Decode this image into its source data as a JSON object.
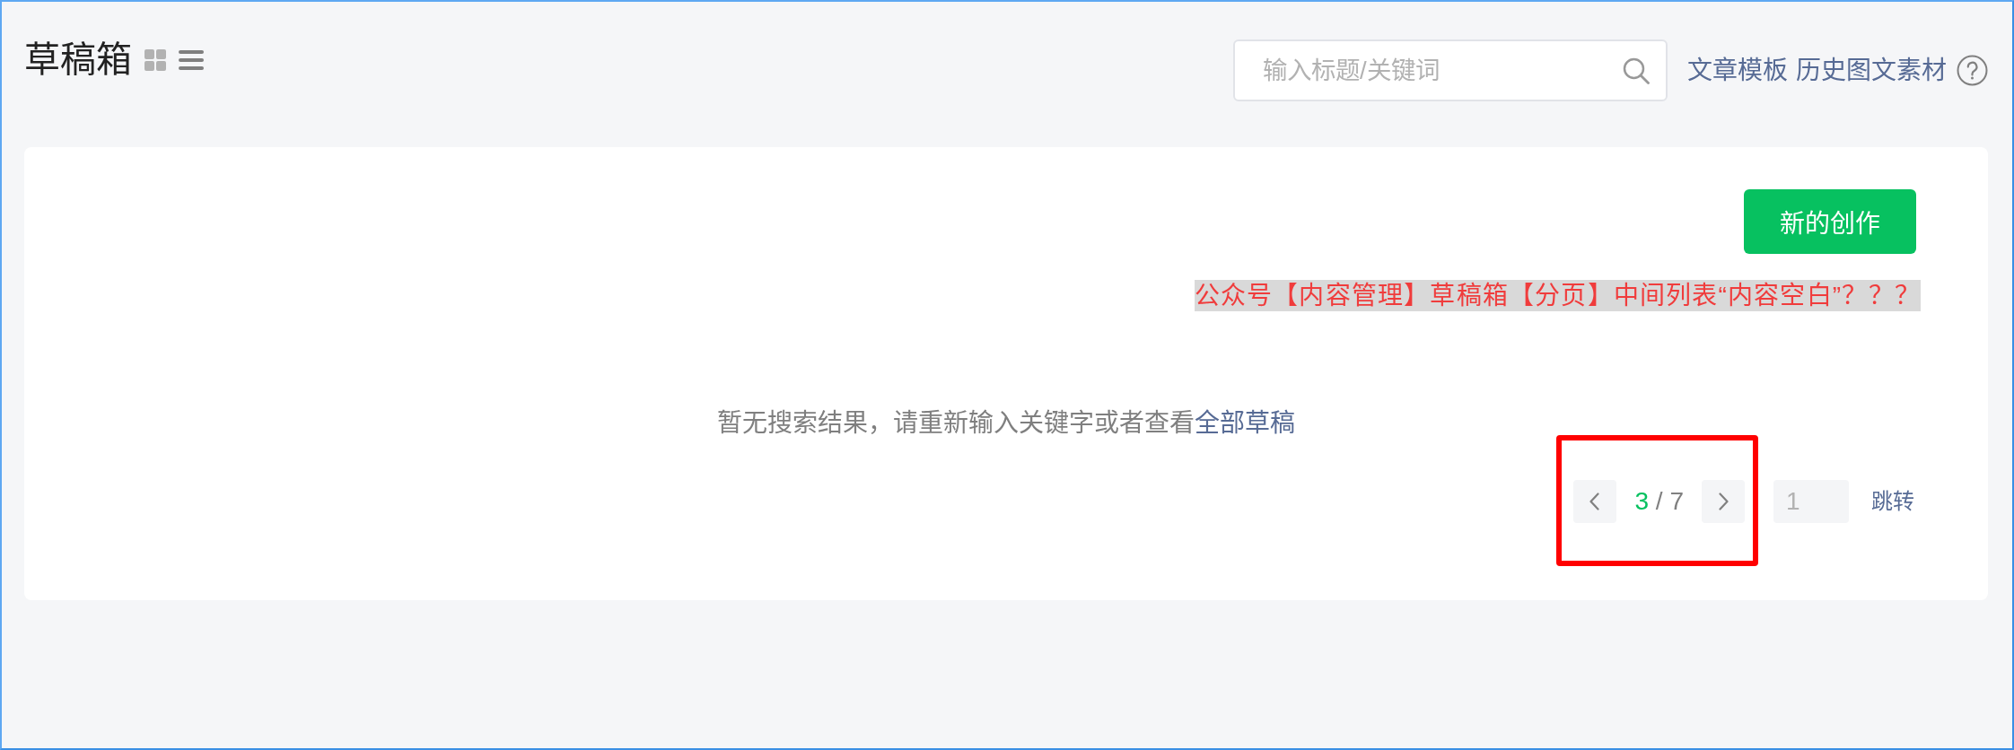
{
  "header": {
    "title": "草稿箱",
    "view_toggle": [
      {
        "kind": "grid",
        "selected": false
      },
      {
        "kind": "list",
        "selected": true
      }
    ],
    "search": {
      "placeholder": "输入标题/关键词"
    },
    "links": [
      "文章模板",
      "历史图文素材"
    ]
  },
  "card": {
    "primary_button": "新的创作",
    "annotation": "公众号【内容管理】草稿箱【分页】中间列表“内容空白”？？？",
    "empty_message": {
      "text": "暂无搜索结果，请重新输入关键字或者查看",
      "link": "全部草稿"
    },
    "pagination": {
      "current": "3",
      "separator": "/",
      "total": "7",
      "jump_input": {
        "placeholder": "1"
      },
      "jump_button": "跳转"
    }
  }
}
